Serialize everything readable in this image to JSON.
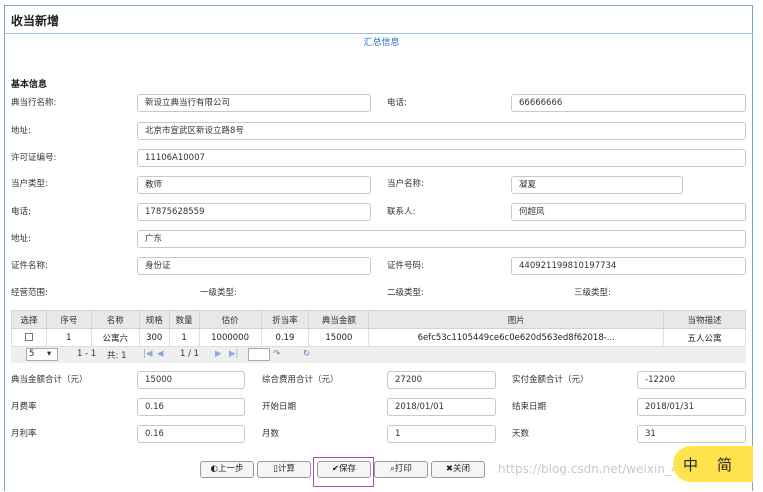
{
  "page": {
    "title": "收当新增",
    "summary_link": "汇总信息",
    "section_basic": "基本信息"
  },
  "form": {
    "pawnshop_name_label": "典当行名称:",
    "pawnshop_name": "新设立典当行有限公司",
    "phone_label": "电话:",
    "phone": "66666666",
    "address_label": "地址:",
    "address": "北京市宣武区新设立路8号",
    "license_label": "许可证编号:",
    "license": "11106A10007",
    "client_type_label": "当户类型:",
    "client_type": "教师",
    "client_name_label": "当户名称:",
    "client_name": "凝夏",
    "client_phone_label": "电话:",
    "client_phone": "17875628559",
    "contact_label": "联系人:",
    "contact": "何超凤",
    "client_address_label": "地址:",
    "client_address": "广东",
    "cert_name_label": "证件名称:",
    "cert_name": "身份证",
    "cert_no_label": "证件号码:",
    "cert_no": "440921199810197734",
    "scope_label": "经营范围:",
    "level1_label": "一级类型:",
    "level2_label": "二级类型:",
    "level3_label": "三级类型:"
  },
  "grid": {
    "headers": [
      "选择",
      "序号",
      "名称",
      "规格",
      "数量",
      "估价",
      "折当率",
      "典当金额",
      "图片",
      "当物描述"
    ],
    "rows": [
      {
        "seq": "1",
        "name": "公寓六",
        "spec": "300",
        "qty": "1",
        "value": "1000000",
        "rate": "0.19",
        "amount": "15000",
        "image": "6efc53c1105449ce6c0e620d563ed8f62018-...",
        "desc": "五人公寓"
      }
    ],
    "pager": {
      "page_size": "5",
      "range": "1 - 1",
      "total": "共: 1",
      "page": "1 / 1"
    }
  },
  "totals": {
    "pawn_total_label": "典当金额合计（元）",
    "pawn_total": "15000",
    "fee_total_label": "综合费用合计（元）",
    "fee_total": "27200",
    "actual_total_label": "实付金额合计（元）",
    "actual_total": "-12200",
    "monthly_fee_label": "月费率",
    "monthly_fee": "0.16",
    "start_label": "开始日期",
    "start": "2018/01/01",
    "end_label": "结束日期",
    "end": "2018/01/31",
    "monthly_rate_label": "月利率",
    "monthly_rate": "0.16",
    "months_label": "月数",
    "months": "1",
    "days_label": "天数",
    "days": "31"
  },
  "buttons": {
    "prev": "上一步",
    "calc": "计算",
    "save": "保存",
    "print": "打印",
    "close": "关闭"
  },
  "overlay": {
    "watermark": "https://blog.csdn.net/weixin_43826171",
    "ime_a": "中",
    "ime_b": "简"
  }
}
